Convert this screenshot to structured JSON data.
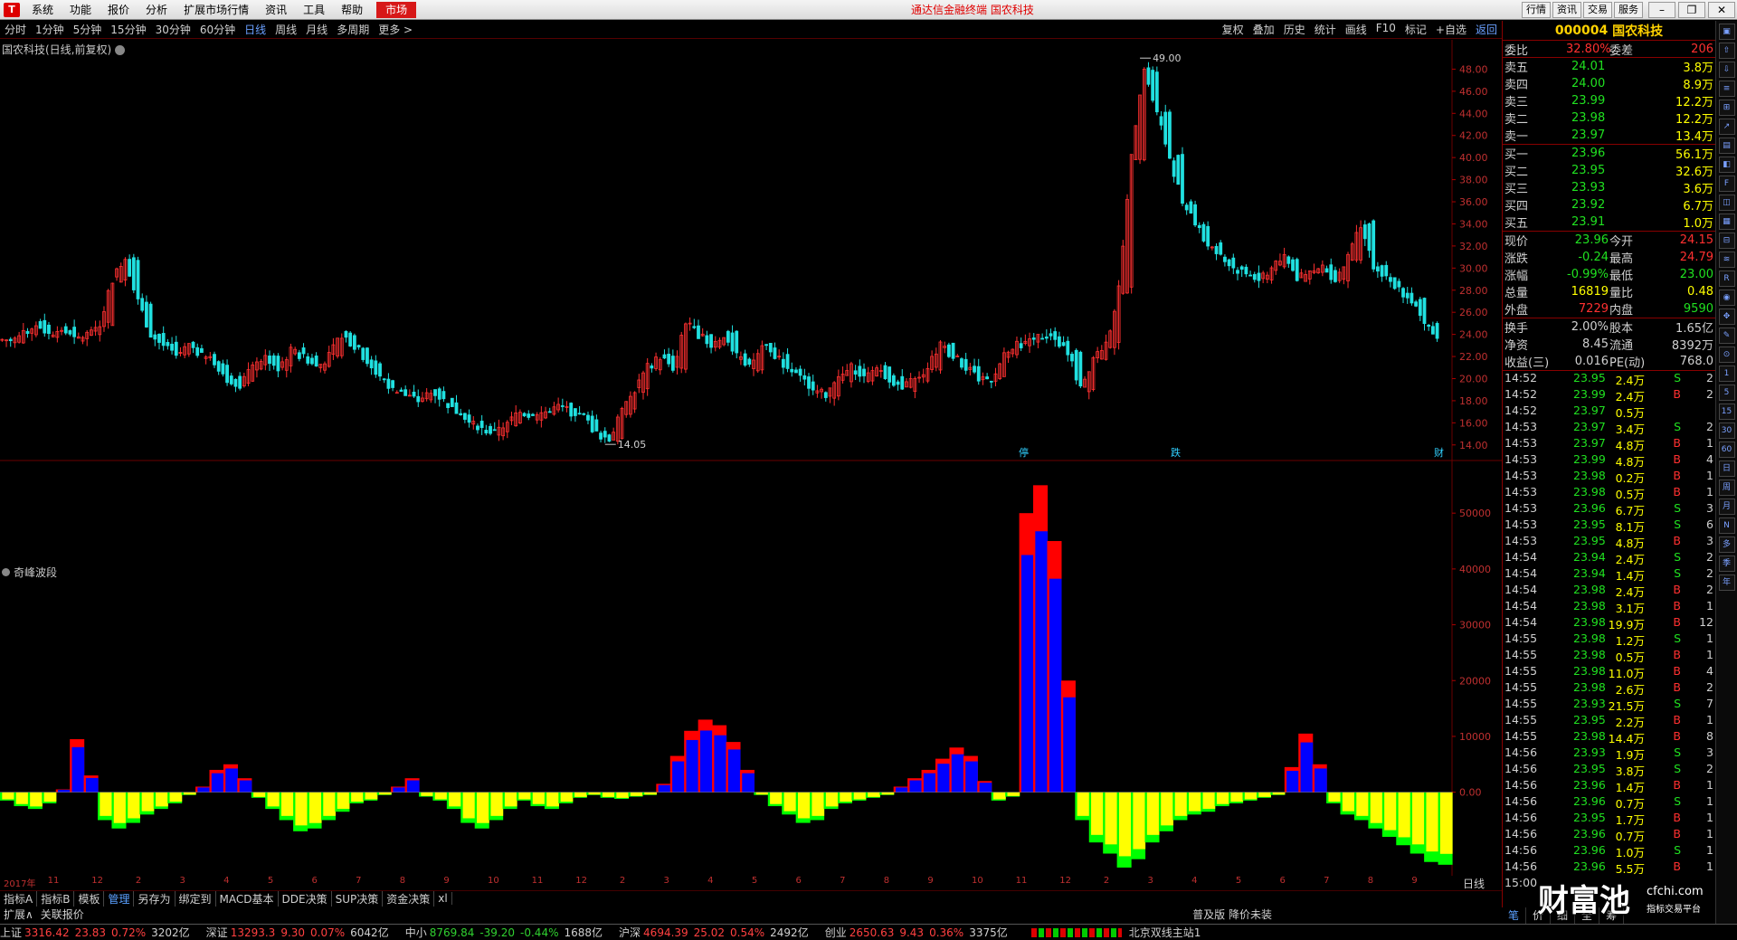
{
  "menu": {
    "items": [
      "系统",
      "功能",
      "报价",
      "分析",
      "扩展市场行情",
      "资讯",
      "工具",
      "帮助"
    ],
    "market": "市场",
    "app_title": "通达信金融终端  国农科技",
    "right_buttons": [
      "行情",
      "资讯",
      "交易",
      "服务"
    ]
  },
  "toolbar": {
    "periods": [
      "分时",
      "1分钟",
      "5分钟",
      "15分钟",
      "30分钟",
      "60分钟",
      "日线",
      "周线",
      "月线",
      "多周期",
      "更多 >"
    ],
    "active_period": "日线",
    "right": [
      "复权",
      "叠加",
      "历史",
      "统计",
      "画线",
      "F10",
      "标记",
      "+自选",
      "返回"
    ]
  },
  "chart_title": "国农科技(日线,前复权)",
  "indicator_title": "奇峰波段",
  "chart_data": [
    {
      "type": "candlestick",
      "title": "国农科技(日线,前复权)",
      "y_ticks": [
        "48.00",
        "46.00",
        "44.00",
        "42.00",
        "40.00",
        "38.00",
        "36.00",
        "34.00",
        "32.00",
        "30.00",
        "28.00",
        "26.00",
        "24.00",
        "22.00",
        "20.00",
        "18.00",
        "16.00",
        "14.00"
      ],
      "ylim": [
        13,
        50
      ],
      "annotations": [
        "49.00",
        "14.05"
      ],
      "markers": [
        "停",
        "跌",
        "财"
      ],
      "close_path": [
        23.5,
        24,
        25,
        24,
        24.5,
        23.5,
        24,
        25,
        29,
        31,
        27,
        24,
        23,
        22,
        23,
        22,
        21.5,
        20,
        19.5,
        21,
        22,
        21,
        22.5,
        22,
        21,
        22,
        24,
        23,
        21.5,
        20,
        19,
        18.5,
        18,
        19,
        18,
        17,
        16,
        15.5,
        15,
        16,
        17,
        16.5,
        17,
        17.5,
        17,
        16.5,
        15,
        14.5,
        17,
        19,
        21,
        22,
        21,
        25,
        24,
        23,
        24,
        22,
        21,
        23,
        22,
        21,
        20,
        19,
        18.5,
        20,
        21,
        20,
        21,
        20,
        19,
        20,
        21,
        23,
        22,
        21,
        20,
        20,
        22,
        23,
        23.5,
        24,
        23.5,
        22.5,
        19,
        22,
        23,
        28,
        40,
        48,
        44,
        40,
        36,
        34,
        32,
        31,
        30,
        29.5,
        29,
        30,
        31,
        29,
        29.5,
        30,
        29,
        31,
        34,
        30,
        29,
        28,
        27,
        25,
        23.5
      ]
    },
    {
      "type": "bar",
      "title": "奇峰波段",
      "y_ticks": [
        "50000",
        "40000",
        "30000",
        "20000",
        "10000",
        "0.00"
      ],
      "ylim": [
        -14000,
        57000
      ],
      "values": [
        -1500,
        -2500,
        -3000,
        -2000,
        500,
        9500,
        3000,
        -5000,
        -6500,
        -5500,
        -4000,
        -3000,
        -2000,
        -500,
        1000,
        4000,
        5000,
        2500,
        -1000,
        -3000,
        -5000,
        -7000,
        -6500,
        -5000,
        -3500,
        -2000,
        -1500,
        -500,
        1000,
        2500,
        -800,
        -1500,
        -3000,
        -5500,
        -6500,
        -5000,
        -3000,
        -1500,
        -2500,
        -3000,
        -2000,
        -1000,
        -500,
        -1000,
        -1200,
        -800,
        -500,
        1500,
        6500,
        11000,
        13000,
        12000,
        9000,
        4000,
        -500,
        -2500,
        -4000,
        -5500,
        -5000,
        -3000,
        -2000,
        -1500,
        -1000,
        -500,
        1000,
        2500,
        4000,
        6000,
        8000,
        6500,
        2000,
        -1500,
        -800,
        50000,
        55000,
        45000,
        20000,
        -5000,
        -9000,
        -11000,
        -13500,
        -12000,
        -9000,
        -7000,
        -5000,
        -4000,
        -3500,
        -2500,
        -2000,
        -1500,
        -1000,
        -500,
        4500,
        10500,
        5000,
        -2000,
        -4000,
        -5000,
        -6500,
        -8000,
        -9500,
        -11000,
        -12500,
        -13000
      ]
    }
  ],
  "date_labels": [
    "2017年",
    "11",
    "12",
    "2",
    "3",
    "4",
    "5",
    "6",
    "7",
    "8",
    "9",
    "10",
    "11",
    "12",
    "2",
    "3",
    "4",
    "5",
    "6",
    "7",
    "8",
    "9",
    "10",
    "11",
    "12",
    "2",
    "3",
    "4",
    "5",
    "6",
    "7",
    "8",
    "9"
  ],
  "tabs1": [
    "指标A",
    "指标B",
    "模板",
    "管理",
    "另存为",
    "绑定到",
    "MACD基本",
    "DDE决策",
    "SUP决策",
    "资金决策",
    "xl"
  ],
  "tabs1_active": "管理",
  "tabs2": [
    "扩展∧",
    "关联报价"
  ],
  "tabs2_right": "普及版 降价未装",
  "period_corner": "日线",
  "panel": {
    "code": "000004",
    "name": "国农科技",
    "weibi_label": "委比",
    "weibi": "32.80%",
    "weicha_label": "委差",
    "weicha": "206",
    "asks": [
      {
        "label": "卖五",
        "price": "24.01",
        "vol": "3.8万"
      },
      {
        "label": "卖四",
        "price": "24.00",
        "vol": "8.9万"
      },
      {
        "label": "卖三",
        "price": "23.99",
        "vol": "12.2万"
      },
      {
        "label": "卖二",
        "price": "23.98",
        "vol": "12.2万"
      },
      {
        "label": "卖一",
        "price": "23.97",
        "vol": "13.4万"
      }
    ],
    "bids": [
      {
        "label": "买一",
        "price": "23.96",
        "vol": "56.1万"
      },
      {
        "label": "买二",
        "price": "23.95",
        "vol": "32.6万"
      },
      {
        "label": "买三",
        "price": "23.93",
        "vol": "3.6万"
      },
      {
        "label": "买四",
        "price": "23.92",
        "vol": "6.7万"
      },
      {
        "label": "买五",
        "price": "23.91",
        "vol": "1.0万"
      }
    ],
    "quote": [
      {
        "l1": "现价",
        "v1": "23.96",
        "l2": "今开",
        "v2": "24.15",
        "c1": "g",
        "c2": "r"
      },
      {
        "l1": "涨跌",
        "v1": "-0.24",
        "l2": "最高",
        "v2": "24.79",
        "c1": "g",
        "c2": "r"
      },
      {
        "l1": "涨幅",
        "v1": "-0.99%",
        "l2": "最低",
        "v2": "23.00",
        "c1": "g",
        "c2": "g"
      },
      {
        "l1": "总量",
        "v1": "16819",
        "l2": "量比",
        "v2": "0.48",
        "c1": "y",
        "c2": "y"
      },
      {
        "l1": "外盘",
        "v1": "7229",
        "l2": "内盘",
        "v2": "9590",
        "c1": "r",
        "c2": "g"
      }
    ],
    "fund": [
      {
        "l1": "换手",
        "v1": "2.00%",
        "l2": "股本",
        "v2": "1.65亿"
      },
      {
        "l1": "净资",
        "v1": "8.45",
        "l2": "流通",
        "v2": "8392万"
      },
      {
        "l1": "收益(三)",
        "v1": "0.016",
        "l2": "PE(动)",
        "v2": "768.0"
      }
    ],
    "ticks": [
      [
        "14:52",
        "23.95",
        "2.4万",
        "S",
        "2"
      ],
      [
        "14:52",
        "23.99",
        "2.4万",
        "B",
        "2"
      ],
      [
        "14:52",
        "23.97",
        "0.5万",
        "",
        ""
      ],
      [
        "14:53",
        "23.97",
        "3.4万",
        "S",
        "2"
      ],
      [
        "14:53",
        "23.97",
        "4.8万",
        "B",
        "1"
      ],
      [
        "14:53",
        "23.99",
        "4.8万",
        "B",
        "4"
      ],
      [
        "14:53",
        "23.98",
        "0.2万",
        "B",
        "1"
      ],
      [
        "14:53",
        "23.98",
        "0.5万",
        "B",
        "1"
      ],
      [
        "14:53",
        "23.96",
        "6.7万",
        "S",
        "3"
      ],
      [
        "14:53",
        "23.95",
        "8.1万",
        "S",
        "6"
      ],
      [
        "14:53",
        "23.95",
        "4.8万",
        "B",
        "3"
      ],
      [
        "14:54",
        "23.94",
        "2.4万",
        "S",
        "2"
      ],
      [
        "14:54",
        "23.94",
        "1.4万",
        "S",
        "2"
      ],
      [
        "14:54",
        "23.98",
        "2.4万",
        "B",
        "2"
      ],
      [
        "14:54",
        "23.98",
        "3.1万",
        "B",
        "1"
      ],
      [
        "14:54",
        "23.98",
        "19.9万",
        "B",
        "12"
      ],
      [
        "14:55",
        "23.98",
        "1.2万",
        "S",
        "1"
      ],
      [
        "14:55",
        "23.98",
        "0.5万",
        "B",
        "1"
      ],
      [
        "14:55",
        "23.98",
        "11.0万",
        "B",
        "4"
      ],
      [
        "14:55",
        "23.98",
        "2.6万",
        "B",
        "2"
      ],
      [
        "14:55",
        "23.93",
        "21.5万",
        "S",
        "7"
      ],
      [
        "14:55",
        "23.95",
        "2.2万",
        "B",
        "1"
      ],
      [
        "14:55",
        "23.98",
        "14.4万",
        "B",
        "8"
      ],
      [
        "14:56",
        "23.93",
        "1.9万",
        "S",
        "3"
      ],
      [
        "14:56",
        "23.95",
        "3.8万",
        "S",
        "2"
      ],
      [
        "14:56",
        "23.96",
        "1.4万",
        "B",
        "1"
      ],
      [
        "14:56",
        "23.96",
        "0.7万",
        "S",
        "1"
      ],
      [
        "14:56",
        "23.95",
        "1.7万",
        "B",
        "1"
      ],
      [
        "14:56",
        "23.96",
        "0.7万",
        "B",
        "1"
      ],
      [
        "14:56",
        "23.96",
        "1.0万",
        "S",
        "1"
      ],
      [
        "14:56",
        "23.96",
        "5.5万",
        "B",
        "1"
      ],
      [
        "15:00",
        "",
        "",
        "",
        ""
      ]
    ]
  },
  "status": [
    {
      "name": "上证",
      "val": "3316.42",
      "chg": "23.83",
      "pct": "0.72%",
      "amt": "3202亿",
      "dir": "up"
    },
    {
      "name": "深证",
      "val": "13293.3",
      "chg": "9.30",
      "pct": "0.07%",
      "amt": "6042亿",
      "dir": "up"
    },
    {
      "name": "中小",
      "val": "8769.84",
      "chg": "-39.20",
      "pct": "-0.44%",
      "amt": "1688亿",
      "dir": "down"
    },
    {
      "name": "沪深",
      "val": "4694.39",
      "chg": "25.02",
      "pct": "0.54%",
      "amt": "2492亿",
      "dir": "up"
    },
    {
      "name": "创业",
      "val": "2650.63",
      "chg": "9.43",
      "pct": "0.36%",
      "amt": "3375亿",
      "dir": "up"
    }
  ],
  "server": "北京双线主站1",
  "watermark": {
    "brand": "财富池",
    "site": "cfchi.com",
    "tag": "指标交易平台"
  },
  "colors": {
    "up": "#ff3030",
    "down": "#20e0e0",
    "grid": "#6a0000",
    "ind_pos_top": "#ff0000",
    "ind_pos": "#0000ff",
    "ind_neg": "#ffff00",
    "ind_neg_edge": "#00ff00"
  }
}
